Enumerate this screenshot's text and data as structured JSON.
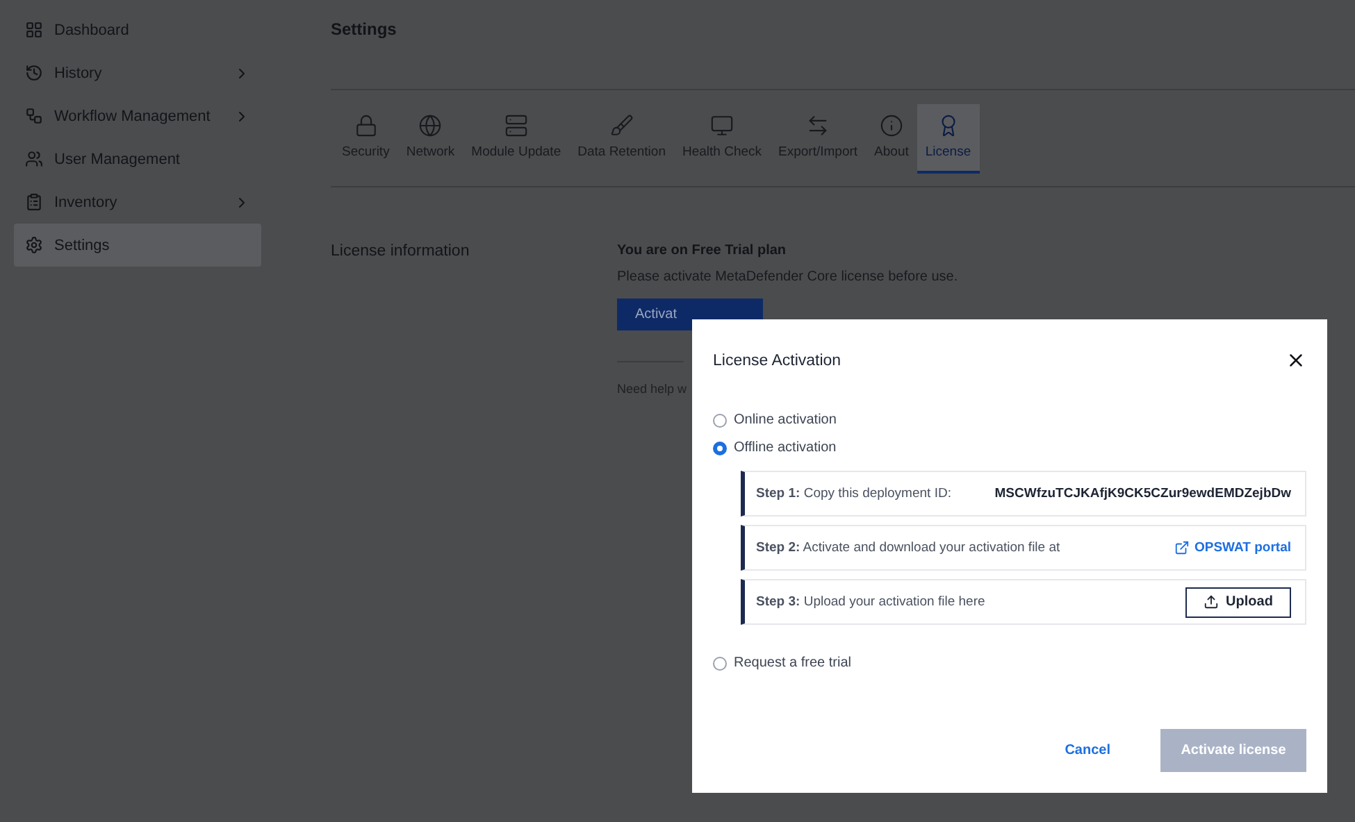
{
  "sidebar": {
    "items": [
      {
        "label": "Dashboard",
        "expandable": false,
        "selected": false
      },
      {
        "label": "History",
        "expandable": true,
        "selected": false
      },
      {
        "label": "Workflow Management",
        "expandable": true,
        "selected": false
      },
      {
        "label": "User Management",
        "expandable": false,
        "selected": false
      },
      {
        "label": "Inventory",
        "expandable": true,
        "selected": false
      },
      {
        "label": "Settings",
        "expandable": false,
        "selected": true
      }
    ]
  },
  "page": {
    "title": "Settings"
  },
  "tabs": [
    {
      "label": "Security",
      "selected": false
    },
    {
      "label": "Network",
      "selected": false
    },
    {
      "label": "Module Update",
      "selected": false
    },
    {
      "label": "Data Retention",
      "selected": false
    },
    {
      "label": "Health Check",
      "selected": false
    },
    {
      "label": "Export/Import",
      "selected": false
    },
    {
      "label": "About",
      "selected": false
    },
    {
      "label": "License",
      "selected": true
    }
  ],
  "license": {
    "section_title": "License information",
    "plan": "You are on Free Trial plan",
    "message": "Please activate MetaDefender Core license before use.",
    "button": "Activat",
    "help": "Need help w"
  },
  "dialog": {
    "title": "License Activation",
    "options": [
      {
        "label": "Online activation",
        "selected": false
      },
      {
        "label": "Offline activation",
        "selected": true,
        "steps": [
          {
            "kind": "value",
            "step": "Step 1:",
            "text": "Copy this deployment ID:",
            "value": "MSCWfzuTCJKAfjK9CK5CZur9ewdEMDZejbDw"
          },
          {
            "kind": "link",
            "step": "Step 2:",
            "text": "Activate and download your activation file at",
            "value": "OPSWAT portal"
          },
          {
            "kind": "button",
            "step": "Step 3:",
            "text": "Upload your activation file here",
            "value": "Upload"
          }
        ]
      },
      {
        "label": "Request a free trial",
        "selected": false
      }
    ],
    "cancel": "Cancel",
    "submit": {
      "label": "Activate license",
      "disabled": true
    }
  }
}
